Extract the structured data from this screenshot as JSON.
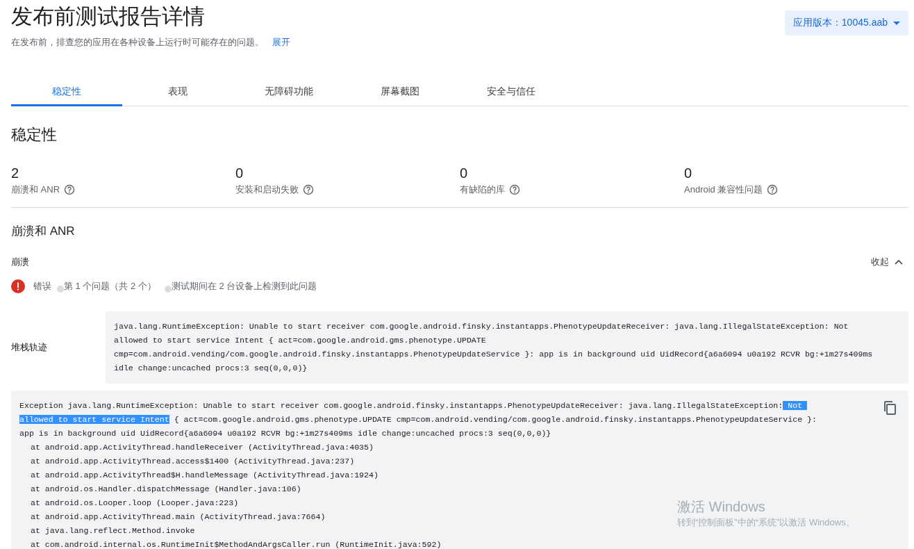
{
  "header": {
    "title": "发布前测试报告详情",
    "subtitle": "在发布前，排查您的应用在各种设备上运行时可能存在的问题。",
    "expand_link": "展开",
    "version_button": "应用版本：10045.aab"
  },
  "tabs": [
    {
      "label": "稳定性",
      "selected": true
    },
    {
      "label": "表现",
      "selected": false
    },
    {
      "label": "无障碍功能",
      "selected": false
    },
    {
      "label": "屏幕截图",
      "selected": false
    },
    {
      "label": "安全与信任",
      "selected": false
    }
  ],
  "section_title": "稳定性",
  "stats": [
    {
      "value": "2",
      "label": "崩溃和 ANR"
    },
    {
      "value": "0",
      "label": "安装和启动失败"
    },
    {
      "value": "0",
      "label": "有缺陷的库"
    },
    {
      "value": "0",
      "label": "Android 兼容性问题"
    }
  ],
  "crashes": {
    "title": "崩溃和 ANR",
    "group_label": "崩溃",
    "collapse_link": "收起",
    "issue": {
      "severity": "错误",
      "meta": [
        "第 1 个问题（共 2 个）",
        "测试期间在 2 台设备上检测到此问题"
      ]
    },
    "stack_label": "堆栈轨迹",
    "stack_summary": [
      "java.lang.RuntimeException: Unable to start receiver com.google.android.finsky.instantapps.PhenotypeUpdateReceiver: java.lang.IllegalStateException: Not",
      "allowed to start service Intent { act=com.google.android.gms.phenotype.UPDATE",
      "cmp=com.android.vending/com.google.android.finsky.instantapps.PhenotypeUpdateService }: app is in background uid UidRecord{a6a6094 u0a192 RCVR bg:+1m27s409ms",
      "idle change:uncached procs:3 seq(0,0,0)}"
    ],
    "stack_full": [
      {
        "kind": "message",
        "segments": [
          {
            "text": "Exception java.lang.RuntimeException: Unable to start receiver com.google.android.finsky.instantapps.PhenotypeUpdateReceiver: java.lang.IllegalStateException:",
            "selected": false
          },
          {
            "text": " Not ",
            "selected": true
          }
        ]
      },
      {
        "kind": "message",
        "segments": [
          {
            "text": "allowed to start service Intent",
            "selected": true
          },
          {
            "text": " { act=com.google.android.gms.phenotype.UPDATE cmp=com.android.vending/com.google.android.finsky.instantapps.PhenotypeUpdateService }:",
            "selected": false
          }
        ]
      },
      {
        "kind": "message",
        "segments": [
          {
            "text": "app is in background uid UidRecord{a6a6094 u0a192 RCVR bg:+1m27s409ms idle change:uncached procs:3 seq(0,0,0)}",
            "selected": false
          }
        ]
      },
      {
        "kind": "frame",
        "segments": [
          {
            "text": "at android.app.ActivityThread.handleReceiver (ActivityThread.java:4035)",
            "selected": false
          }
        ]
      },
      {
        "kind": "frame",
        "segments": [
          {
            "text": "at android.app.ActivityThread.access$1400 (ActivityThread.java:237)",
            "selected": false
          }
        ]
      },
      {
        "kind": "frame",
        "segments": [
          {
            "text": "at android.app.ActivityThread$H.handleMessage (ActivityThread.java:1924)",
            "selected": false
          }
        ]
      },
      {
        "kind": "frame",
        "segments": [
          {
            "text": "at android.os.Handler.dispatchMessage (Handler.java:106)",
            "selected": false
          }
        ]
      },
      {
        "kind": "frame",
        "segments": [
          {
            "text": "at android.os.Looper.loop (Looper.java:223)",
            "selected": false
          }
        ]
      },
      {
        "kind": "frame",
        "segments": [
          {
            "text": "at android.app.ActivityThread.main (ActivityThread.java:7664)",
            "selected": false
          }
        ]
      },
      {
        "kind": "frame",
        "segments": [
          {
            "text": "at java.lang.reflect.Method.invoke",
            "selected": false
          }
        ]
      },
      {
        "kind": "frame",
        "segments": [
          {
            "text": "at com.android.internal.os.RuntimeInit$MethodAndArgsCaller.run (RuntimeInit.java:592)",
            "selected": false
          }
        ]
      }
    ]
  },
  "os_notice": {
    "title": "激活 Windows",
    "text": "转到“控制面板”中的“系统”以激活 Windows。"
  }
}
